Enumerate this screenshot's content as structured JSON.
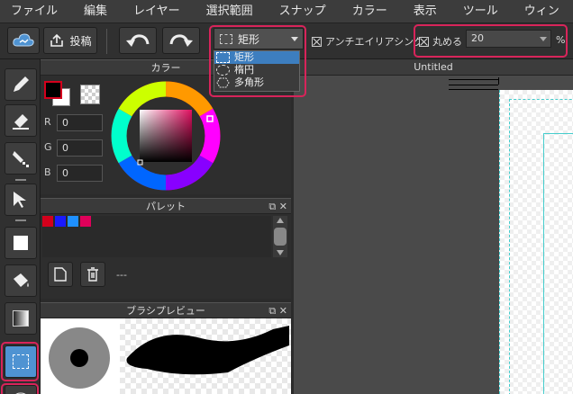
{
  "menu": [
    "ファイル",
    "編集",
    "レイヤー",
    "選択範囲",
    "スナップ",
    "カラー",
    "表示",
    "ツール",
    "ウィン"
  ],
  "toolbar": {
    "post_label": "投稿",
    "shape_value": "矩形",
    "antialias_label": "アンチエイリアシング",
    "round_label": "丸める",
    "round_value": "20",
    "percent": "%"
  },
  "shape_options": [
    "矩形",
    "楕円",
    "多角形"
  ],
  "panels": {
    "color_title": "カラー",
    "palette_title": "パレット",
    "brush_preview_title": "ブラシプレビュー",
    "palette_name": "---"
  },
  "rgb": {
    "r_label": "R",
    "r_value": "0",
    "g_label": "G",
    "g_value": "0",
    "b_label": "B",
    "b_value": "0"
  },
  "palette_colors": [
    "#d4001c",
    "#1a1aff",
    "#1e90ff",
    "#e0005a"
  ],
  "canvas": {
    "title": "Untitled"
  },
  "colors": {
    "accent_highlight": "#d8245a",
    "selected_tool": "#4f93d2"
  },
  "icons": [
    "cloud-icon",
    "upload-icon",
    "undo-icon",
    "redo-icon",
    "pen-icon",
    "eraser-icon",
    "fill-icon",
    "move-icon",
    "rect-fill-icon",
    "bucket-icon",
    "gradient-icon",
    "rect-select-icon",
    "new-palette-icon",
    "trash-icon"
  ]
}
